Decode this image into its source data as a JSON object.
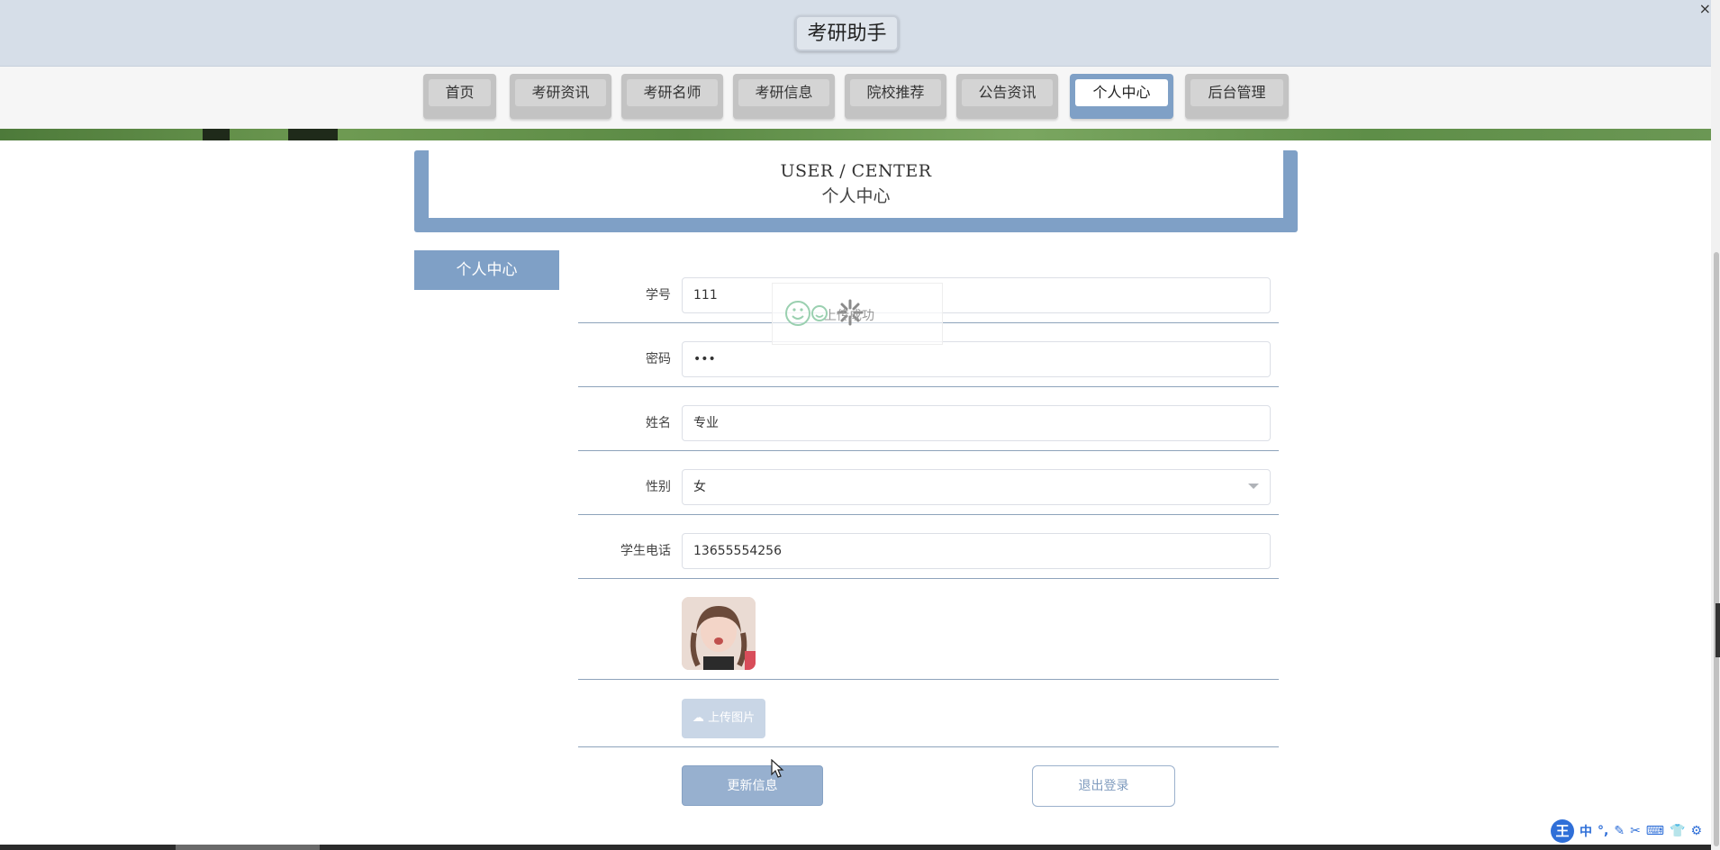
{
  "header": {
    "app_title": "考研助手",
    "close_glyph": "×"
  },
  "nav": {
    "items": [
      {
        "label": "首页"
      },
      {
        "label": "考研资讯"
      },
      {
        "label": "考研名师"
      },
      {
        "label": "考研信息"
      },
      {
        "label": "院校推荐"
      },
      {
        "label": "公告资讯"
      },
      {
        "label": "个人中心",
        "active": true
      },
      {
        "label": "后台管理"
      }
    ]
  },
  "section": {
    "title_en": "USER / CENTER",
    "title_cn": "个人中心"
  },
  "sidebar": {
    "tab_label": "个人中心"
  },
  "form": {
    "student_id": {
      "label": "学号",
      "value": "111"
    },
    "password": {
      "label": "密码",
      "value": "•••"
    },
    "name": {
      "label": "姓名",
      "value": "专业"
    },
    "gender": {
      "label": "性别",
      "value": "女"
    },
    "phone": {
      "label": "学生电话",
      "value": "13655554256"
    }
  },
  "upload": {
    "label": "上传图片",
    "icon": "cloud-upload-icon"
  },
  "actions": {
    "update_label": "更新信息",
    "logout_label": "退出登录"
  },
  "overlay": {
    "text": "上传成功"
  },
  "ime": {
    "logo": "王",
    "items": [
      "中",
      "°,",
      "✎",
      "✂",
      "⌨",
      "👕",
      "⚙"
    ]
  },
  "colors": {
    "accent": "#7fa0c6",
    "header_bg": "#d6dee8",
    "button": "#97b0cf"
  }
}
